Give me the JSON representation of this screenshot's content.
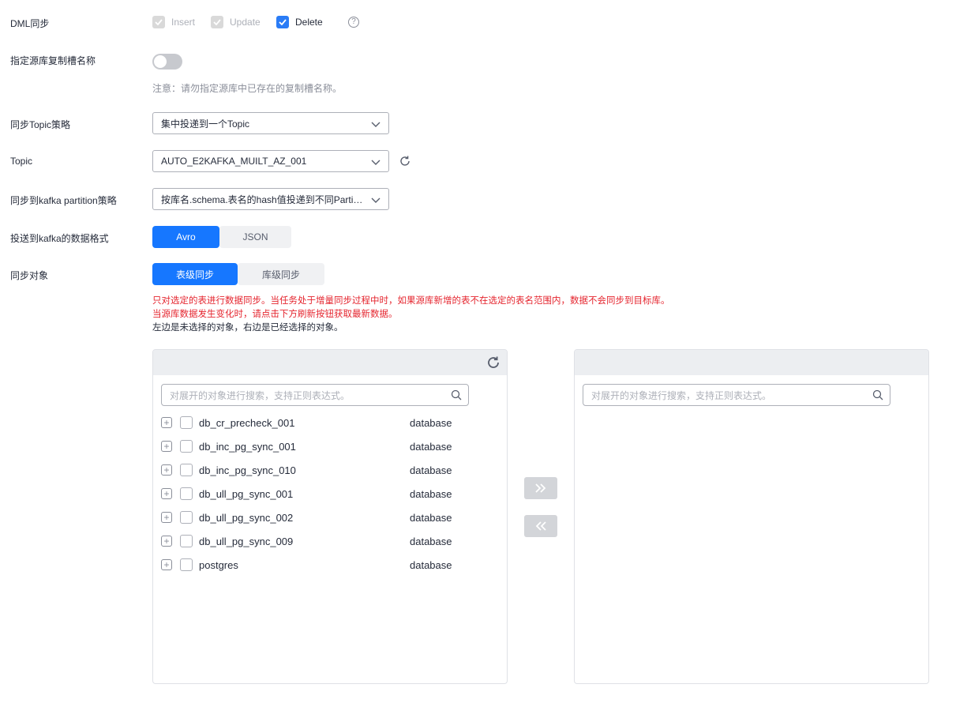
{
  "dml": {
    "label": "DML同步",
    "options": [
      {
        "label": "Insert",
        "checked": true,
        "disabled": true
      },
      {
        "label": "Update",
        "checked": true,
        "disabled": true
      },
      {
        "label": "Delete",
        "checked": true,
        "disabled": false
      }
    ],
    "help_icon": "question-circle-icon",
    "help_glyph": "?"
  },
  "slot": {
    "label": "指定源库复制槽名称",
    "enabled": false,
    "note": "注意：请勿指定源库中已存在的复制槽名称。"
  },
  "topic_strategy": {
    "label": "同步Topic策略",
    "value": "集中投递到一个Topic"
  },
  "topic": {
    "label": "Topic",
    "value": "AUTO_E2KAFKA_MUILT_AZ_001"
  },
  "partition_strategy": {
    "label": "同步到kafka partition策略",
    "value": "按库名.schema.表名的hash值投递到不同Partition"
  },
  "data_format": {
    "label": "投送到kafka的数据格式",
    "options": [
      "Avro",
      "JSON"
    ],
    "selected": "Avro"
  },
  "sync_object": {
    "label": "同步对象",
    "options": [
      "表级同步",
      "库级同步"
    ],
    "selected": "表级同步",
    "warn1": "只对选定的表进行数据同步。当任务处于增量同步过程中时，如果源库新增的表不在选定的表名范围内，数据不会同步到目标库。",
    "warn2": "当源库数据发生变化时，请点击下方刷新按钮获取最新数据。",
    "info": "左边是未选择的对象，右边是已经选择的对象。"
  },
  "left_panel": {
    "search_placeholder": "对展开的对象进行搜索，支持正则表达式。",
    "items": [
      {
        "name": "db_cr_precheck_001",
        "type": "database"
      },
      {
        "name": "db_inc_pg_sync_001",
        "type": "database"
      },
      {
        "name": "db_inc_pg_sync_010",
        "type": "database"
      },
      {
        "name": "db_ull_pg_sync_001",
        "type": "database"
      },
      {
        "name": "db_ull_pg_sync_002",
        "type": "database"
      },
      {
        "name": "db_ull_pg_sync_009",
        "type": "database"
      },
      {
        "name": "postgres",
        "type": "database"
      }
    ]
  },
  "right_panel": {
    "search_placeholder": "对展开的对象进行搜索，支持正则表达式。",
    "items": []
  },
  "transfer": {
    "add_icon": "double-chevron-right-icon",
    "remove_icon": "double-chevron-left-icon"
  },
  "colors": {
    "primary": "#1677ff",
    "warning": "#e5262f",
    "disabled": "#d9d9d9"
  }
}
